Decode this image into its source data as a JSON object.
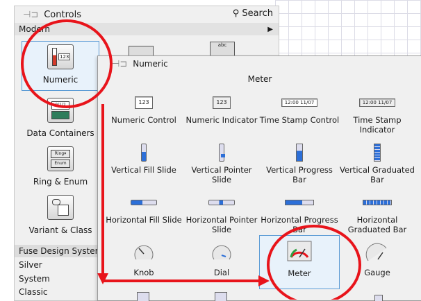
{
  "controls": {
    "title": "Controls",
    "search_label": "Search",
    "modern_label": "Modern",
    "items": [
      {
        "label": "Numeric"
      },
      {
        "label": "Data Containers"
      },
      {
        "label": "Ring & Enum"
      },
      {
        "label": "Variant & Class"
      }
    ],
    "categories": [
      "Fuse Design System",
      "Silver",
      "System",
      "Classic"
    ]
  },
  "numeric": {
    "title": "Numeric",
    "section_label": "Meter",
    "cells": [
      {
        "label": "Numeric Control",
        "icon": "numeric-control-icon",
        "text": "123"
      },
      {
        "label": "Numeric Indicator",
        "icon": "numeric-indicator-icon",
        "text": "123"
      },
      {
        "label": "Time Stamp Control",
        "icon": "timestamp-control-icon",
        "text": "12:00 11/07"
      },
      {
        "label": "Time Stamp Indicator",
        "icon": "timestamp-indicator-icon",
        "text": "12:00 11/07"
      },
      {
        "label": "Vertical Fill Slide",
        "icon": "vertical-fill-slide-icon"
      },
      {
        "label": "Vertical Pointer Slide",
        "icon": "vertical-pointer-slide-icon"
      },
      {
        "label": "Vertical Progress Bar",
        "icon": "vertical-progress-bar-icon"
      },
      {
        "label": "Vertical Graduated Bar",
        "icon": "vertical-graduated-bar-icon"
      },
      {
        "label": "Horizontal Fill Slide",
        "icon": "horizontal-fill-slide-icon"
      },
      {
        "label": "Horizontal Pointer Slide",
        "icon": "horizontal-pointer-slide-icon"
      },
      {
        "label": "Horizontal Progress Bar",
        "icon": "horizontal-progress-bar-icon"
      },
      {
        "label": "Horizontal Graduated Bar",
        "icon": "horizontal-graduated-bar-icon"
      },
      {
        "label": "Knob",
        "icon": "knob-icon"
      },
      {
        "label": "Dial",
        "icon": "dial-icon"
      },
      {
        "label": "Meter",
        "icon": "meter-icon"
      },
      {
        "label": "Gauge",
        "icon": "gauge-icon"
      }
    ]
  },
  "colors": {
    "annotation_red": "#e8141b",
    "selection_blue": "#5b9bd5",
    "fill_blue": "#2c6fd8"
  }
}
